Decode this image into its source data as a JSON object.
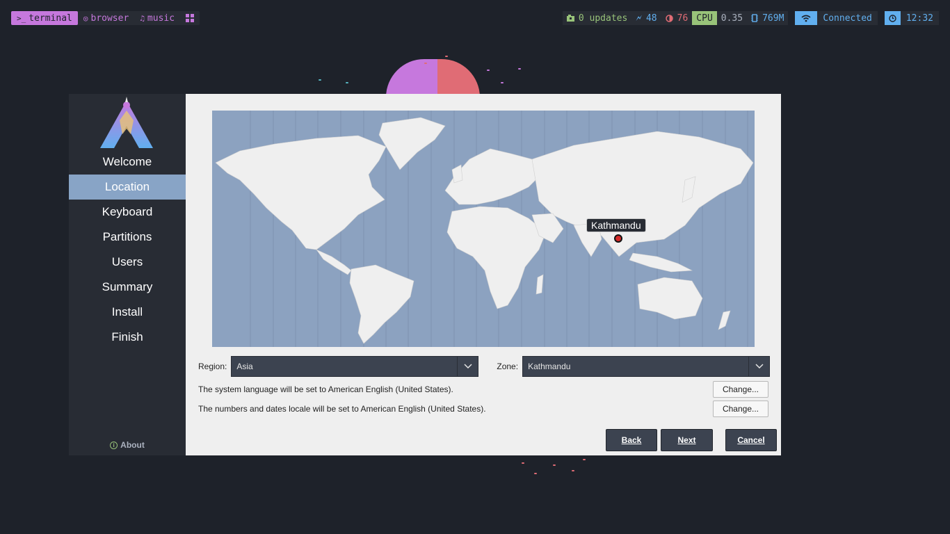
{
  "topbar": {
    "workspaces": [
      {
        "icon": "terminal-icon",
        "glyph": ">_",
        "label": "terminal",
        "active": true
      },
      {
        "icon": "browser-icon",
        "glyph": "◎",
        "label": "browser",
        "active": false
      },
      {
        "icon": "music-icon",
        "glyph": "♫",
        "label": "music",
        "active": false
      }
    ],
    "updates": "0 updates",
    "battery": "48",
    "brightness": "76",
    "cpu_label": "CPU",
    "cpu_value": "0.35",
    "mem_value": "769M",
    "wifi_status": "Connected",
    "clock": "12:32",
    "colors": {
      "accent_purple": "#c678dd",
      "green": "#98c379",
      "blue": "#61afef",
      "red": "#e06c75"
    }
  },
  "sidebar": {
    "items": [
      {
        "label": "Welcome",
        "active": false
      },
      {
        "label": "Location",
        "active": true
      },
      {
        "label": "Keyboard",
        "active": false
      },
      {
        "label": "Partitions",
        "active": false
      },
      {
        "label": "Users",
        "active": false
      },
      {
        "label": "Summary",
        "active": false
      },
      {
        "label": "Install",
        "active": false
      },
      {
        "label": "Finish",
        "active": false
      }
    ],
    "about": "About"
  },
  "map": {
    "selected_city": "Kathmandu"
  },
  "location": {
    "region_label": "Region:",
    "region_value": "Asia",
    "zone_label": "Zone:",
    "zone_value": "Kathmandu",
    "language_text": "The system language will be set to American English (United States).",
    "locale_text": "The numbers and dates locale will be set to American English (United States).",
    "change_label": "Change..."
  },
  "buttons": {
    "back": "Back",
    "next": "Next",
    "cancel": "Cancel"
  }
}
